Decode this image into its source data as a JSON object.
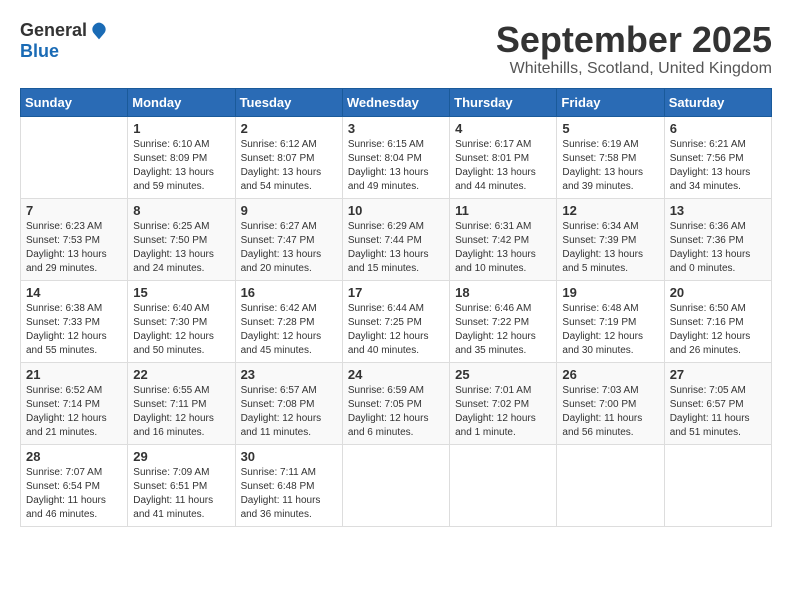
{
  "logo": {
    "general": "General",
    "blue": "Blue"
  },
  "title": "September 2025",
  "location": "Whitehills, Scotland, United Kingdom",
  "days_header": [
    "Sunday",
    "Monday",
    "Tuesday",
    "Wednesday",
    "Thursday",
    "Friday",
    "Saturday"
  ],
  "weeks": [
    [
      {
        "day": "",
        "sunrise": "",
        "sunset": "",
        "daylight": ""
      },
      {
        "day": "1",
        "sunrise": "Sunrise: 6:10 AM",
        "sunset": "Sunset: 8:09 PM",
        "daylight": "Daylight: 13 hours and 59 minutes."
      },
      {
        "day": "2",
        "sunrise": "Sunrise: 6:12 AM",
        "sunset": "Sunset: 8:07 PM",
        "daylight": "Daylight: 13 hours and 54 minutes."
      },
      {
        "day": "3",
        "sunrise": "Sunrise: 6:15 AM",
        "sunset": "Sunset: 8:04 PM",
        "daylight": "Daylight: 13 hours and 49 minutes."
      },
      {
        "day": "4",
        "sunrise": "Sunrise: 6:17 AM",
        "sunset": "Sunset: 8:01 PM",
        "daylight": "Daylight: 13 hours and 44 minutes."
      },
      {
        "day": "5",
        "sunrise": "Sunrise: 6:19 AM",
        "sunset": "Sunset: 7:58 PM",
        "daylight": "Daylight: 13 hours and 39 minutes."
      },
      {
        "day": "6",
        "sunrise": "Sunrise: 6:21 AM",
        "sunset": "Sunset: 7:56 PM",
        "daylight": "Daylight: 13 hours and 34 minutes."
      }
    ],
    [
      {
        "day": "7",
        "sunrise": "Sunrise: 6:23 AM",
        "sunset": "Sunset: 7:53 PM",
        "daylight": "Daylight: 13 hours and 29 minutes."
      },
      {
        "day": "8",
        "sunrise": "Sunrise: 6:25 AM",
        "sunset": "Sunset: 7:50 PM",
        "daylight": "Daylight: 13 hours and 24 minutes."
      },
      {
        "day": "9",
        "sunrise": "Sunrise: 6:27 AM",
        "sunset": "Sunset: 7:47 PM",
        "daylight": "Daylight: 13 hours and 20 minutes."
      },
      {
        "day": "10",
        "sunrise": "Sunrise: 6:29 AM",
        "sunset": "Sunset: 7:44 PM",
        "daylight": "Daylight: 13 hours and 15 minutes."
      },
      {
        "day": "11",
        "sunrise": "Sunrise: 6:31 AM",
        "sunset": "Sunset: 7:42 PM",
        "daylight": "Daylight: 13 hours and 10 minutes."
      },
      {
        "day": "12",
        "sunrise": "Sunrise: 6:34 AM",
        "sunset": "Sunset: 7:39 PM",
        "daylight": "Daylight: 13 hours and 5 minutes."
      },
      {
        "day": "13",
        "sunrise": "Sunrise: 6:36 AM",
        "sunset": "Sunset: 7:36 PM",
        "daylight": "Daylight: 13 hours and 0 minutes."
      }
    ],
    [
      {
        "day": "14",
        "sunrise": "Sunrise: 6:38 AM",
        "sunset": "Sunset: 7:33 PM",
        "daylight": "Daylight: 12 hours and 55 minutes."
      },
      {
        "day": "15",
        "sunrise": "Sunrise: 6:40 AM",
        "sunset": "Sunset: 7:30 PM",
        "daylight": "Daylight: 12 hours and 50 minutes."
      },
      {
        "day": "16",
        "sunrise": "Sunrise: 6:42 AM",
        "sunset": "Sunset: 7:28 PM",
        "daylight": "Daylight: 12 hours and 45 minutes."
      },
      {
        "day": "17",
        "sunrise": "Sunrise: 6:44 AM",
        "sunset": "Sunset: 7:25 PM",
        "daylight": "Daylight: 12 hours and 40 minutes."
      },
      {
        "day": "18",
        "sunrise": "Sunrise: 6:46 AM",
        "sunset": "Sunset: 7:22 PM",
        "daylight": "Daylight: 12 hours and 35 minutes."
      },
      {
        "day": "19",
        "sunrise": "Sunrise: 6:48 AM",
        "sunset": "Sunset: 7:19 PM",
        "daylight": "Daylight: 12 hours and 30 minutes."
      },
      {
        "day": "20",
        "sunrise": "Sunrise: 6:50 AM",
        "sunset": "Sunset: 7:16 PM",
        "daylight": "Daylight: 12 hours and 26 minutes."
      }
    ],
    [
      {
        "day": "21",
        "sunrise": "Sunrise: 6:52 AM",
        "sunset": "Sunset: 7:14 PM",
        "daylight": "Daylight: 12 hours and 21 minutes."
      },
      {
        "day": "22",
        "sunrise": "Sunrise: 6:55 AM",
        "sunset": "Sunset: 7:11 PM",
        "daylight": "Daylight: 12 hours and 16 minutes."
      },
      {
        "day": "23",
        "sunrise": "Sunrise: 6:57 AM",
        "sunset": "Sunset: 7:08 PM",
        "daylight": "Daylight: 12 hours and 11 minutes."
      },
      {
        "day": "24",
        "sunrise": "Sunrise: 6:59 AM",
        "sunset": "Sunset: 7:05 PM",
        "daylight": "Daylight: 12 hours and 6 minutes."
      },
      {
        "day": "25",
        "sunrise": "Sunrise: 7:01 AM",
        "sunset": "Sunset: 7:02 PM",
        "daylight": "Daylight: 12 hours and 1 minute."
      },
      {
        "day": "26",
        "sunrise": "Sunrise: 7:03 AM",
        "sunset": "Sunset: 7:00 PM",
        "daylight": "Daylight: 11 hours and 56 minutes."
      },
      {
        "day": "27",
        "sunrise": "Sunrise: 7:05 AM",
        "sunset": "Sunset: 6:57 PM",
        "daylight": "Daylight: 11 hours and 51 minutes."
      }
    ],
    [
      {
        "day": "28",
        "sunrise": "Sunrise: 7:07 AM",
        "sunset": "Sunset: 6:54 PM",
        "daylight": "Daylight: 11 hours and 46 minutes."
      },
      {
        "day": "29",
        "sunrise": "Sunrise: 7:09 AM",
        "sunset": "Sunset: 6:51 PM",
        "daylight": "Daylight: 11 hours and 41 minutes."
      },
      {
        "day": "30",
        "sunrise": "Sunrise: 7:11 AM",
        "sunset": "Sunset: 6:48 PM",
        "daylight": "Daylight: 11 hours and 36 minutes."
      },
      {
        "day": "",
        "sunrise": "",
        "sunset": "",
        "daylight": ""
      },
      {
        "day": "",
        "sunrise": "",
        "sunset": "",
        "daylight": ""
      },
      {
        "day": "",
        "sunrise": "",
        "sunset": "",
        "daylight": ""
      },
      {
        "day": "",
        "sunrise": "",
        "sunset": "",
        "daylight": ""
      }
    ]
  ]
}
